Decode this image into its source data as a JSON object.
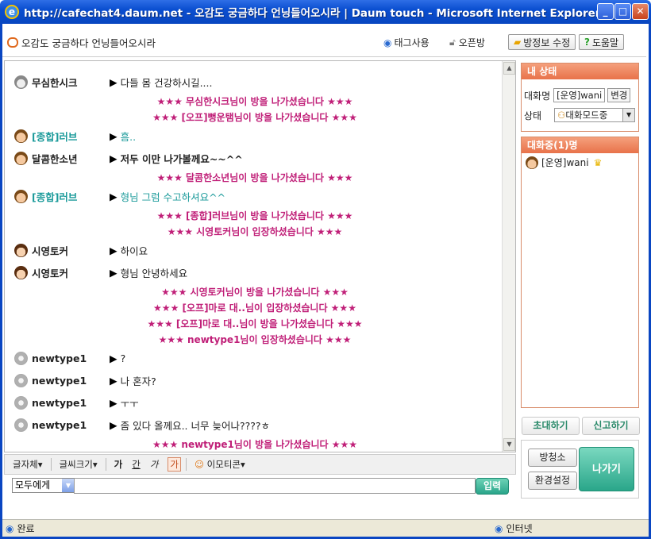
{
  "window": {
    "title": "http://cafechat4.daum.net - 오감도 궁금하다 언닝들어오시라 | Daum touch - Microsoft Internet Explorer",
    "min": "_",
    "max": "□",
    "close": "✕"
  },
  "toolbar": {
    "room_title": "오감도 궁금하다 언닝들어오시라",
    "tag_label": "태그사용",
    "open_label": "오픈방",
    "roominfo_label": "방정보 수정",
    "help_label": "도움말"
  },
  "messages": [
    {
      "nick": "무심한시크",
      "text": "다들 몸 건강하시길....",
      "avatar": "gray-pro"
    },
    {
      "nick": "[종합]러브",
      "text": "흠..",
      "avatar": "boy",
      "teal": true
    },
    {
      "nick": "달콤한소년",
      "text": "저두 이만 나가볼께요~~^^",
      "avatar": "boy"
    },
    {
      "nick": "[종합]러브",
      "text": "형님 그럼 수고하셔요^^",
      "avatar": "boy",
      "teal": true
    },
    {
      "nick": "시영토커",
      "text": "하이요",
      "avatar": "girl"
    },
    {
      "nick": "시영토커",
      "text": "형님 안녕하세요",
      "avatar": "girl"
    },
    {
      "nick": "newtype1",
      "text": "?",
      "avatar": "gray"
    },
    {
      "nick": "newtype1",
      "text": "나 혼자?",
      "avatar": "gray"
    },
    {
      "nick": "newtype1",
      "text": "ㅜㅜ",
      "avatar": "gray"
    },
    {
      "nick": "newtype1",
      "text": "좀 있다 올께요.. 너무 늦어나????ㅎ",
      "avatar": "gray"
    }
  ],
  "system": [
    "★★★ 무심한시크님이 방을 나가셨습니다 ★★★",
    "★★★ [오프]뻥운탬님이 방을 나가셨습니다 ★★★",
    "★★★ 달콤한소년님이 방을 나가셨습니다 ★★★",
    "★★★ [종합]러브님이 방을 나가셨습니다 ★★★",
    "★★★ 시영토커님이 입장하셨습니다 ★★★",
    "★★★ 시영토커님이 방을 나가셨습니다 ★★★",
    "★★★ [오프]마로 대..님이 입장하셨습니다 ★★★",
    "★★★ [오프]마로 대..님이 방을 나가셨습니다 ★★★",
    "★★★ newtype1님이 입장하셨습니다 ★★★",
    "★★★ newtype1님이 방을 나가셨습니다 ★★★"
  ],
  "options": {
    "font": "글자체",
    "size": "글씨크기",
    "bold": "가",
    "underline": "간",
    "italic": "가",
    "color": "가",
    "emoticon": "이모티콘"
  },
  "input": {
    "target": "모두에게",
    "value": "",
    "send": "입력"
  },
  "my_status": {
    "header": "내 상태",
    "nick_label": "대화명",
    "nick_value": "[운영]wani",
    "change": "변경",
    "state_label": "상태",
    "state_value": "대화모드중"
  },
  "users": {
    "header": "대화중(1)명",
    "list": [
      "[운영]wani"
    ]
  },
  "side_buttons": {
    "invite": "초대하기",
    "report": "신고하기",
    "room_owner": "방청소",
    "settings": "환경설정",
    "exit": "나가기"
  },
  "statusbar": {
    "done": "완료",
    "zone": "인터넷"
  }
}
